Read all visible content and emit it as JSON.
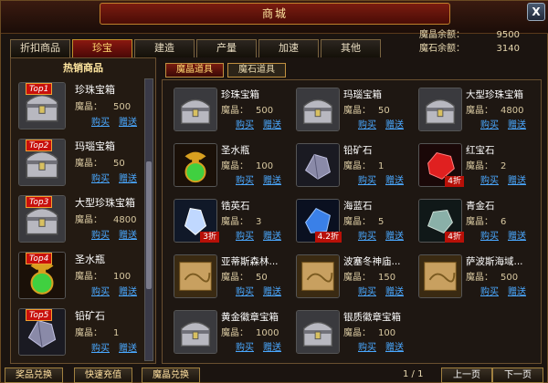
{
  "window": {
    "title": "商城",
    "close_label": "X"
  },
  "tabs": [
    "折扣商品",
    "珍宝",
    "建造",
    "产量",
    "加速",
    "其他"
  ],
  "active_tab": 1,
  "balance": {
    "crystal_label": "魔晶余额：",
    "crystal_value": "9500",
    "stone_label": "魔石余额：",
    "stone_value": "3140"
  },
  "hot": {
    "title": "热销商品",
    "items": [
      {
        "rank": "Top1",
        "name": "珍珠宝箱",
        "price_label": "魔晶：",
        "price": "500",
        "buy": "购买",
        "gift": "赠送",
        "icon": "chest-icon"
      },
      {
        "rank": "Top2",
        "name": "玛瑙宝箱",
        "price_label": "魔晶：",
        "price": "50",
        "buy": "购买",
        "gift": "赠送",
        "icon": "chest-icon"
      },
      {
        "rank": "Top3",
        "name": "大型珍珠宝箱",
        "price_label": "魔晶：",
        "price": "4800",
        "buy": "购买",
        "gift": "赠送",
        "icon": "chest-icon"
      },
      {
        "rank": "Top4",
        "name": "圣水瓶",
        "price_label": "魔晶：",
        "price": "100",
        "buy": "购买",
        "gift": "赠送",
        "icon": "potion-icon"
      },
      {
        "rank": "Top5",
        "name": "铅矿石",
        "price_label": "魔晶：",
        "price": "1",
        "buy": "购买",
        "gift": "赠送",
        "icon": "ore-icon"
      }
    ]
  },
  "subtabs": [
    "魔晶道具",
    "魔石道具"
  ],
  "active_subtab": 0,
  "grid": [
    {
      "name": "珍珠宝箱",
      "price_label": "魔晶：",
      "price": "500",
      "buy": "购买",
      "gift": "赠送",
      "icon": "chest-icon",
      "discount": ""
    },
    {
      "name": "玛瑙宝箱",
      "price_label": "魔晶：",
      "price": "50",
      "buy": "购买",
      "gift": "赠送",
      "icon": "chest-icon",
      "discount": ""
    },
    {
      "name": "大型珍珠宝箱",
      "price_label": "魔晶：",
      "price": "4800",
      "buy": "购买",
      "gift": "赠送",
      "icon": "chest-icon",
      "discount": ""
    },
    {
      "name": "圣水瓶",
      "price_label": "魔晶：",
      "price": "100",
      "buy": "购买",
      "gift": "赠送",
      "icon": "potion-icon",
      "discount": ""
    },
    {
      "name": "铅矿石",
      "price_label": "魔晶：",
      "price": "1",
      "buy": "购买",
      "gift": "赠送",
      "icon": "ore-icon",
      "discount": ""
    },
    {
      "name": "红宝石",
      "price_label": "魔晶：",
      "price": "2",
      "buy": "购买",
      "gift": "赠送",
      "icon": "ruby-icon",
      "discount": "4折"
    },
    {
      "name": "锆英石",
      "price_label": "魔晶：",
      "price": "3",
      "buy": "购买",
      "gift": "赠送",
      "icon": "zircon-icon",
      "discount": "3折"
    },
    {
      "name": "海蓝石",
      "price_label": "魔晶：",
      "price": "5",
      "buy": "购买",
      "gift": "赠送",
      "icon": "aquamarine-icon",
      "discount": "4.2折"
    },
    {
      "name": "青金石",
      "price_label": "魔晶：",
      "price": "6",
      "buy": "购买",
      "gift": "赠送",
      "icon": "lapis-icon",
      "discount": "4折"
    },
    {
      "name": "亚蒂斯森林...",
      "price_label": "魔晶：",
      "price": "50",
      "buy": "购买",
      "gift": "赠送",
      "icon": "map-icon",
      "discount": ""
    },
    {
      "name": "波塞冬神庙...",
      "price_label": "魔晶：",
      "price": "150",
      "buy": "购买",
      "gift": "赠送",
      "icon": "map-icon",
      "discount": ""
    },
    {
      "name": "萨波斯海域...",
      "price_label": "魔晶：",
      "price": "500",
      "buy": "购买",
      "gift": "赠送",
      "icon": "map-icon",
      "discount": ""
    },
    {
      "name": "黄金徽章宝箱",
      "price_label": "魔晶：",
      "price": "1000",
      "buy": "购买",
      "gift": "赠送",
      "icon": "chest-icon",
      "discount": ""
    },
    {
      "name": "银质徽章宝箱",
      "price_label": "魔晶：",
      "price": "100",
      "buy": "购买",
      "gift": "赠送",
      "icon": "chest-icon",
      "discount": ""
    }
  ],
  "bottom": {
    "btn1": "奖品兑换",
    "btn2": "快速充值",
    "btn3": "魔晶兑换",
    "page": "1 / 1",
    "prev": "上一页",
    "next": "下一页"
  }
}
